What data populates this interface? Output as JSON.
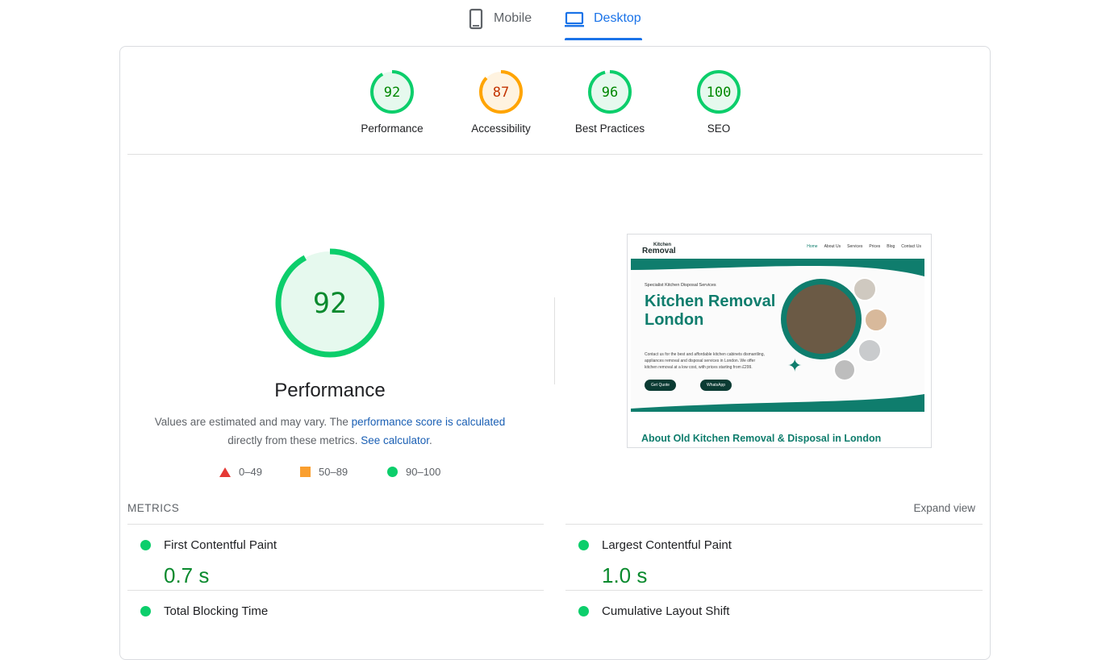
{
  "tabs": [
    {
      "label": "Mobile",
      "icon": "phone-icon"
    },
    {
      "label": "Desktop",
      "icon": "laptop-icon",
      "active": true
    }
  ],
  "categories": [
    {
      "label": "Performance",
      "score": "92",
      "value": 92,
      "status": "pass"
    },
    {
      "label": "Accessibility",
      "score": "87",
      "value": 87,
      "status": "average"
    },
    {
      "label": "Best Practices",
      "score": "96",
      "value": 96,
      "status": "pass"
    },
    {
      "label": "SEO",
      "score": "100",
      "value": 100,
      "status": "pass"
    }
  ],
  "main_gauge": {
    "score": "92",
    "value": 92,
    "title": "Performance"
  },
  "description": {
    "text1": "Values are estimated and may vary. The ",
    "link1": "performance score is calculated",
    "text2": "directly from these metrics. ",
    "link2": "See calculator",
    "text3": "."
  },
  "legend": [
    {
      "range": "0–49",
      "shape": "triangle"
    },
    {
      "range": "50–89",
      "shape": "square"
    },
    {
      "range": "90–100",
      "shape": "circle"
    }
  ],
  "preview": {
    "logo_top": "Kitchen",
    "logo_bottom": "Removal",
    "nav": [
      "Home",
      "About Us",
      "Services",
      "Prices",
      "Blog",
      "Contact Us"
    ],
    "tagline": "Specialist Kitchen Disposal Services",
    "heading": "Kitchen Removal London",
    "paragraph": "Contact us for the best and affordable kitchen cabinets dismantling, appliances removal and disposal services in London. We offer kitchen removal at a low cost, with prices starting from £299.",
    "btn_quote": "Get Quote",
    "btn_whatsapp": "WhatsApp",
    "about_heading": "About Old Kitchen Removal & Disposal in London"
  },
  "metrics": {
    "heading": "METRICS",
    "expand": "Expand view",
    "items": [
      {
        "title": "First Contentful Paint",
        "value": "0.7 s"
      },
      {
        "title": "Largest Contentful Paint",
        "value": "1.0 s"
      },
      {
        "title": "Total Blocking Time",
        "value": ""
      },
      {
        "title": "Cumulative Layout Shift",
        "value": ""
      }
    ]
  },
  "colors": {
    "pass": "#0cce6b",
    "pass_text": "#008800",
    "pass_bg": "#e6f9ee",
    "average": "#ffa400",
    "average_text": "#c33300",
    "average_bg": "#fff3e0",
    "accent": "#1a73e8",
    "brand_teal": "#0f7d6d"
  }
}
